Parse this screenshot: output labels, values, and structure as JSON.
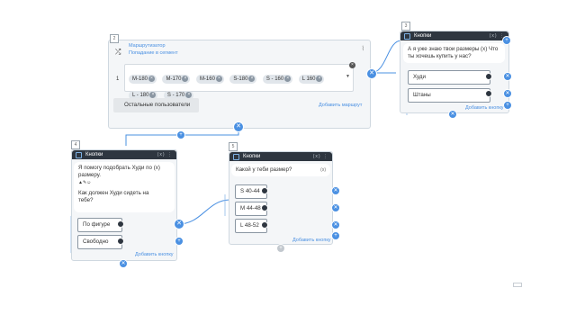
{
  "router": {
    "number": "2",
    "title": "Маршрутизатор",
    "subtitle": "Попадание в сегмент",
    "row_number": "1",
    "tags": [
      "M-180",
      "M-170",
      "M-160",
      "S-180",
      "S - 160",
      "L 160",
      "L - 180",
      "S - 170"
    ],
    "rest_label": "Остальные пользователи",
    "add_route": "Добавить маршрут"
  },
  "buttons3": {
    "number": "3",
    "title": "Кнопки",
    "message": "А я уже знаю твои размеры (x) Что ты хочешь купить у нас?",
    "options": [
      "Худи",
      "Штаны"
    ],
    "add_button": "Добавить кнопку"
  },
  "buttons4": {
    "number": "4",
    "title": "Кнопки",
    "message_line1": "Я помогу подобрать Худи по (x)",
    "message_line2": "размеру.",
    "message_line3": "Как должен Худи сидеть на",
    "message_line4": "тебе?",
    "options": [
      "По фигуре",
      "Свободно"
    ],
    "add_button": "Добавить кнопку"
  },
  "buttons5": {
    "number": "5",
    "title": "Кнопки",
    "message": "Какой у теби размер?",
    "var": "(x)",
    "options": [
      "S 40-44",
      "M 44-48",
      "L 48-52"
    ],
    "add_button": "Добавить кнопку"
  },
  "colors": {
    "accent": "#4a90e2",
    "header": "#2e3640",
    "node_bg": "#f4f6f8"
  },
  "icons": {
    "shuffle": "shuffle-icon",
    "edit": "edit-icon",
    "attach": "paperclip-icon",
    "menu": "dots-icon"
  }
}
